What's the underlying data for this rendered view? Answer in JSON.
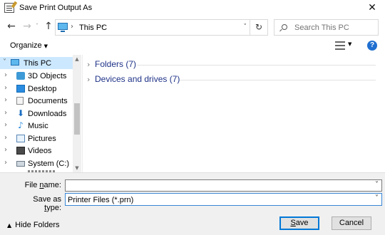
{
  "window": {
    "title": "Save Print Output As",
    "close_glyph": "✕"
  },
  "nav": {
    "back_glyph": "←",
    "forward_glyph": "→",
    "recent_glyph": "˅",
    "up_glyph": "↑",
    "address": {
      "location": "This PC",
      "separator": "›",
      "dropdown_glyph": "˅"
    },
    "refresh_glyph": "↻",
    "search_placeholder": "Search This PC"
  },
  "toolbar": {
    "organize_label": "Organize",
    "caret": "▼",
    "help_glyph": "?"
  },
  "sidebar": {
    "root": {
      "label": "This PC",
      "arrow": "˅",
      "icon": "pc-icon"
    },
    "items": [
      {
        "label": "3D Objects",
        "arrow": "›",
        "icon": "3d-objects-icon"
      },
      {
        "label": "Desktop",
        "arrow": "›",
        "icon": "desktop-icon"
      },
      {
        "label": "Documents",
        "arrow": "›",
        "icon": "documents-icon"
      },
      {
        "label": "Downloads",
        "arrow": "›",
        "icon": "downloads-icon"
      },
      {
        "label": "Music",
        "arrow": "›",
        "icon": "music-icon"
      },
      {
        "label": "Pictures",
        "arrow": "›",
        "icon": "pictures-icon"
      },
      {
        "label": "Videos",
        "arrow": "›",
        "icon": "videos-icon"
      },
      {
        "label": "System (C:)",
        "arrow": "›",
        "icon": "drive-icon"
      }
    ],
    "download_glyph": "⬇",
    "music_glyph": "♪",
    "scroll_up": "▲",
    "scroll_down": "▼"
  },
  "main": {
    "groups": [
      {
        "label": "Folders (7)",
        "chevron": "›"
      },
      {
        "label": "Devices and drives (7)",
        "chevron": "›"
      }
    ]
  },
  "form": {
    "file_name_label_u": "n",
    "file_name_label_pre": "File ",
    "file_name_label_post": "ame:",
    "file_name_value": "",
    "save_type_label_pre": "Save as ",
    "save_type_label_u": "t",
    "save_type_label_post": "ype:",
    "save_type_value": "Printer Files (*.prn)",
    "dropdown_glyph": "˅"
  },
  "footer": {
    "hide_folders_label": "Hide Folders",
    "hide_caret": "▲",
    "save_label_u": "S",
    "save_label_post": "ave",
    "cancel_label": "Cancel"
  },
  "colors": {
    "accent": "#0078d7",
    "selection": "#cce8ff",
    "group_text": "#1e3287",
    "help": "#1f6fd0"
  }
}
